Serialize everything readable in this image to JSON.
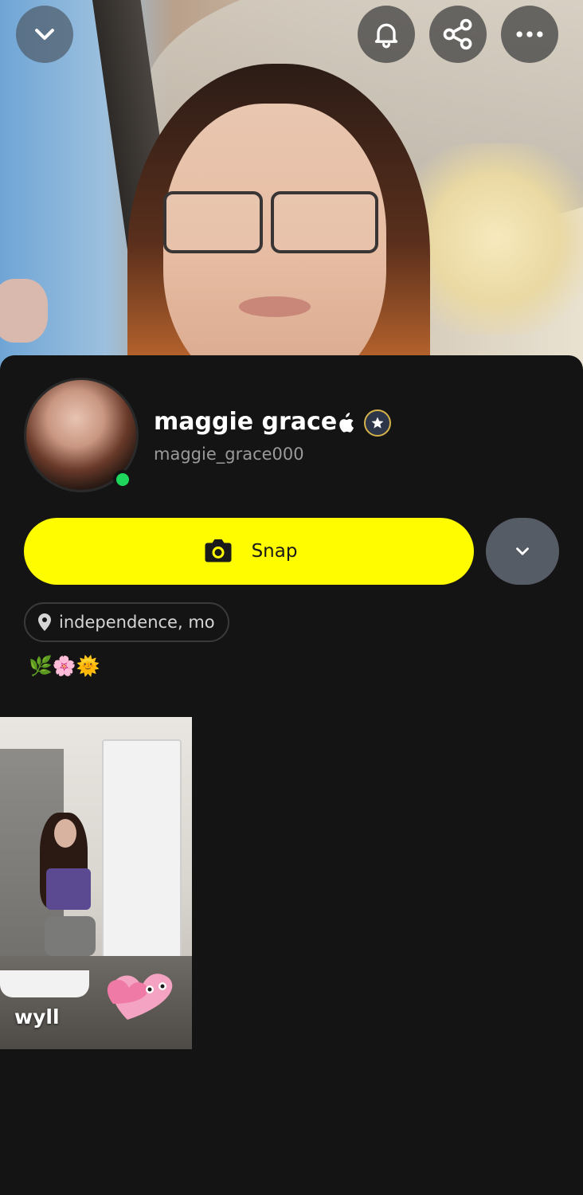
{
  "profile": {
    "display_name": "maggie grace",
    "username": "maggie_grace000",
    "online": true
  },
  "actions": {
    "snap_label": "Snap"
  },
  "location": {
    "text": "independence, mo"
  },
  "bio": {
    "text": "🌿🌸🌞"
  },
  "stories": [
    {
      "caption": "wyll"
    }
  ],
  "top_bar": {
    "icons": [
      "chevron-down-icon",
      "bell-icon",
      "share-icon",
      "more-icon"
    ]
  },
  "colors": {
    "accent": "#fffc00",
    "background": "#141414",
    "online": "#1fd65c",
    "muted_text": "#9a9a9a"
  }
}
